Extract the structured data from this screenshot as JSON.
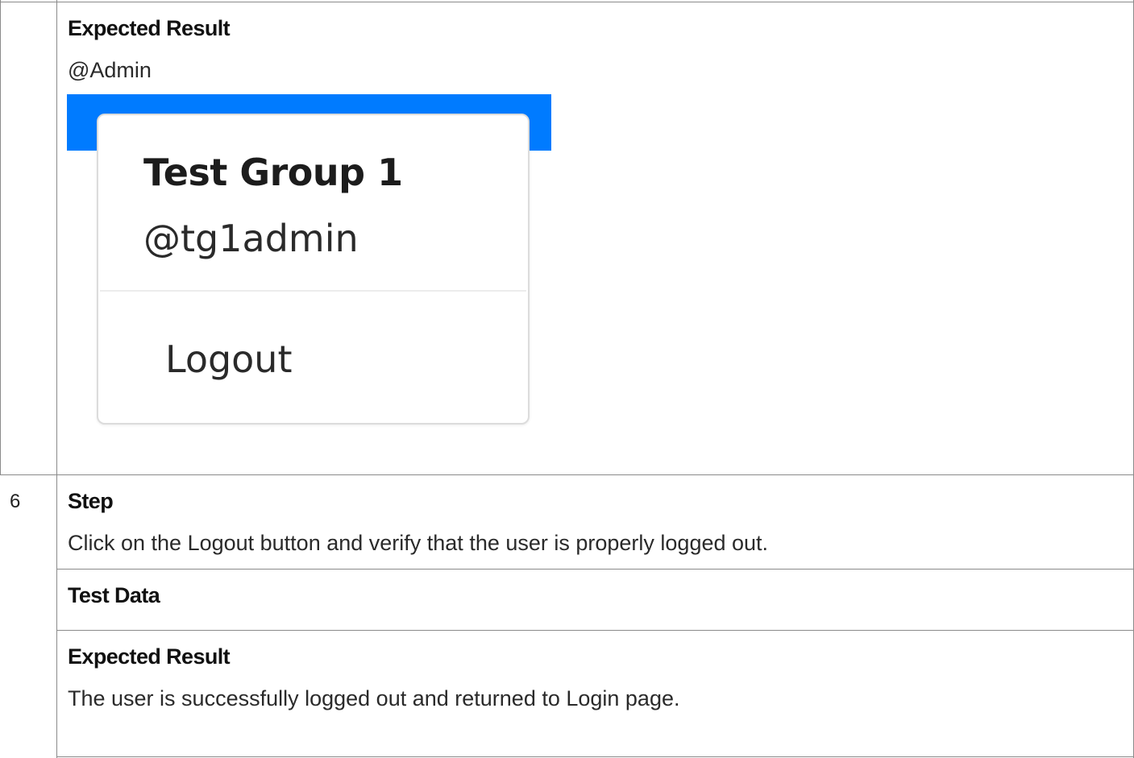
{
  "row_prev": {
    "expected_heading": "Expected Result",
    "expected_text": "@Admin",
    "screenshot": {
      "accent_color": "#007bff",
      "group_name": "Test Group 1",
      "username": "@tg1admin",
      "logout_label": "Logout"
    }
  },
  "row6": {
    "number": "6",
    "step_heading": "Step",
    "step_text": "Click on the Logout button and verify that the user is properly logged out.",
    "test_data_heading": "Test Data",
    "expected_heading": "Expected Result",
    "expected_text": "The user is successfully logged out and returned to Login page."
  }
}
